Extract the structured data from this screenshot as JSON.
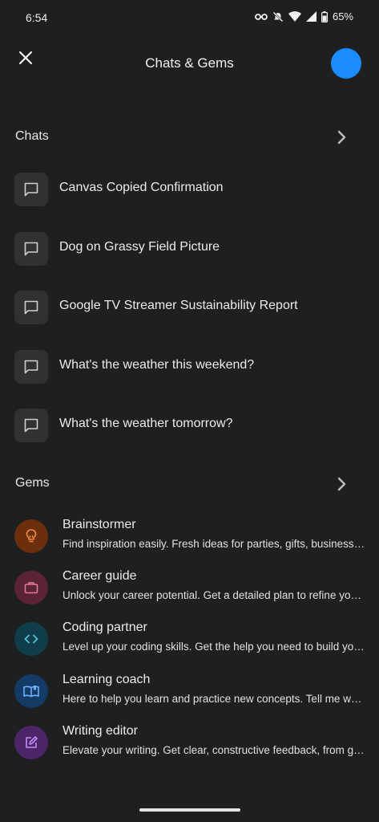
{
  "status": {
    "time": "6:54",
    "battery": "65%"
  },
  "header": {
    "title": "Chats & Gems"
  },
  "chats": {
    "title": "Chats",
    "items": [
      {
        "label": "Canvas Copied Confirmation"
      },
      {
        "label": "Dog on Grassy Field Picture"
      },
      {
        "label": "Google TV Streamer Sustainability Report"
      },
      {
        "label": "What's the weather this weekend?"
      },
      {
        "label": "What's the weather tomorrow?"
      }
    ]
  },
  "gems": {
    "title": "Gems",
    "items": [
      {
        "name": "Brainstormer",
        "desc": "Find inspiration easily. Fresh ideas for parties, gifts, business plans and more",
        "icon": "lightbulb-icon",
        "bg": "#6b2f0c",
        "fg": "#f08a3c"
      },
      {
        "name": "Career guide",
        "desc": "Unlock your career potential. Get a detailed plan to refine your skills",
        "icon": "briefcase-icon",
        "bg": "#5a2336",
        "fg": "#e07a93"
      },
      {
        "name": "Coding partner",
        "desc": "Level up your coding skills. Get the help you need to build your projects",
        "icon": "code-icon",
        "bg": "#0f3d4a",
        "fg": "#4fc3dd"
      },
      {
        "name": "Learning coach",
        "desc": "Here to help you learn and practice new concepts. Tell me what you want to learn",
        "icon": "book-icon",
        "bg": "#143a66",
        "fg": "#6fb0ff"
      },
      {
        "name": "Writing editor",
        "desc": "Elevate your writing. Get clear, constructive feedback, from grammar to structure",
        "icon": "edit-icon",
        "bg": "#4c2468",
        "fg": "#c28cf2"
      }
    ]
  }
}
